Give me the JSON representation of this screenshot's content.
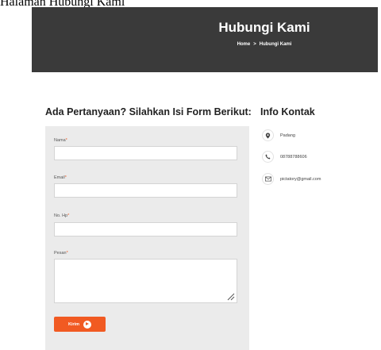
{
  "caption": "Halaman Hubungi Kami",
  "banner": {
    "title": "Hubungi Kami",
    "breadcrumb": {
      "home": "Home",
      "separator": ">",
      "current": "Hubungi Kami"
    }
  },
  "form": {
    "title": "Ada Pertanyaan? Silahkan Isi Form Berikut:",
    "required_mark": "*",
    "fields": [
      {
        "label": "Nama",
        "value": "",
        "placeholder": ""
      },
      {
        "label": "Email",
        "value": "",
        "placeholder": ""
      },
      {
        "label": "No. Hp",
        "value": "",
        "placeholder": ""
      },
      {
        "label": "Pesan",
        "value": "",
        "placeholder": ""
      }
    ],
    "submit_label": "Kirim",
    "submit_icon": "send-icon"
  },
  "contact": {
    "title": "Info Kontak",
    "items": [
      {
        "icon": "map-pin-icon",
        "text": "Padang"
      },
      {
        "icon": "phone-icon",
        "text": "08788788606"
      },
      {
        "icon": "email-icon",
        "text": "pictatory@gmail.com"
      }
    ]
  },
  "colors": {
    "accent": "#f15a22",
    "banner_bg": "#3a3a3a",
    "panel_bg": "#ebebeb"
  }
}
